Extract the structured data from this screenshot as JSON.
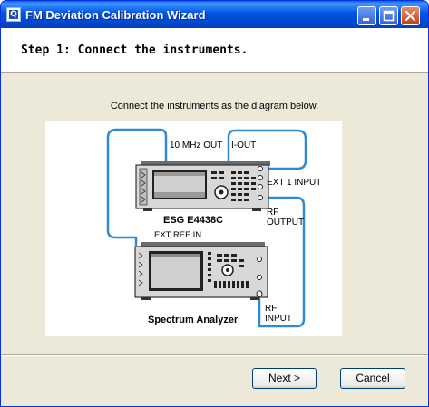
{
  "window": {
    "title": "FM Deviation Calibration Wizard",
    "icon": "app-icon"
  },
  "header": {
    "step_text": "Step 1: Connect the instruments."
  },
  "main": {
    "instruction": "Connect the instruments as the diagram below.",
    "diagram": {
      "label_10mhz_out": "10 MHz OUT",
      "label_i_out": "I-OUT",
      "label_ext1_input": "EXT 1 INPUT",
      "label_rf_output_1": "RF",
      "label_rf_output_2": "OUTPUT",
      "label_esg": "ESG E4438C",
      "label_ext_ref_in": "EXT REF IN",
      "label_spectrum_analyzer": "Spectrum Analyzer",
      "label_rf_input_1": "RF",
      "label_rf_input_2": "INPUT",
      "cable_color": "#2f8ad6"
    }
  },
  "footer": {
    "next_label": "Next >",
    "cancel_label": "Cancel"
  }
}
